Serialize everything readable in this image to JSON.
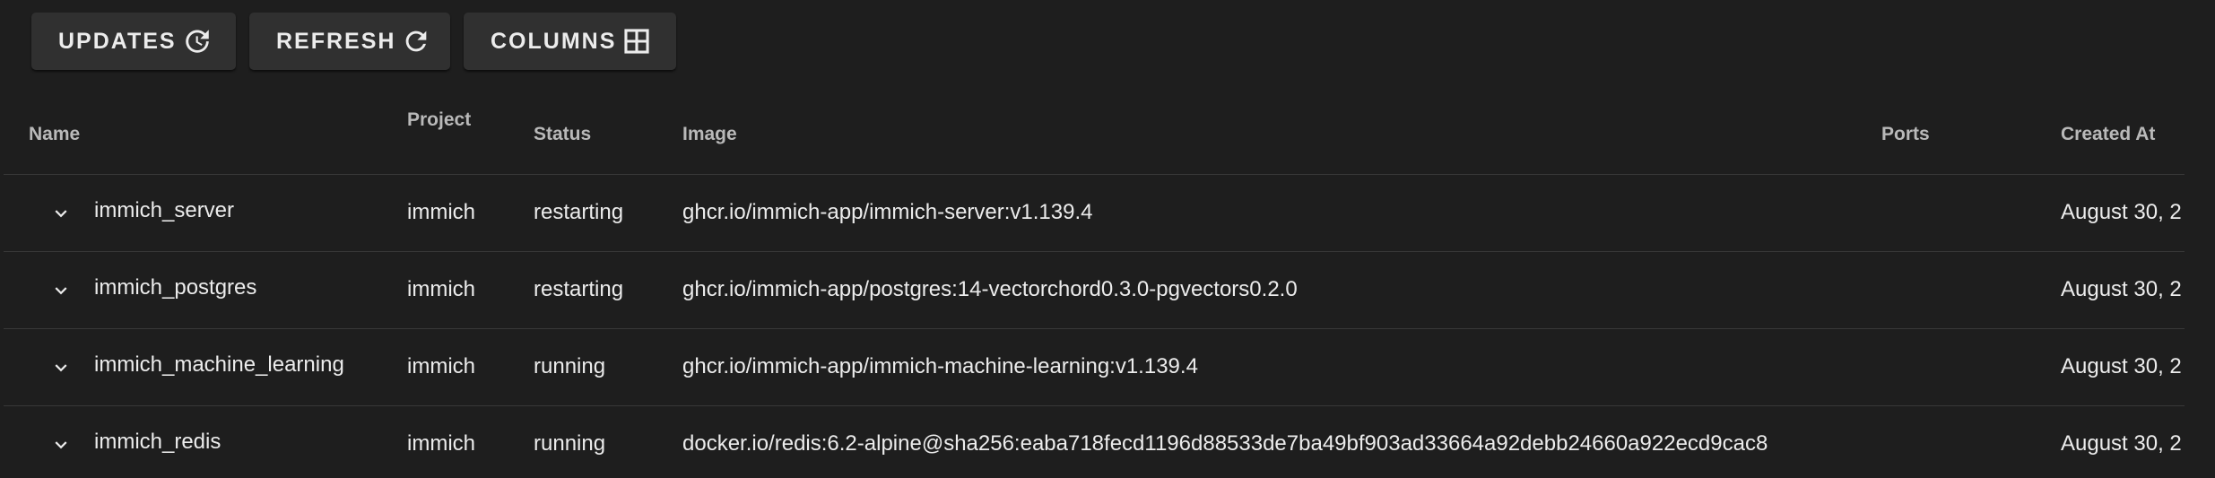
{
  "toolbar": {
    "updates_label": "UPDATES",
    "updates_icon": "update-history-icon",
    "refresh_label": "REFRESH",
    "refresh_icon": "refresh-icon",
    "columns_label": "COLUMNS",
    "columns_icon": "columns-grid-icon"
  },
  "table": {
    "headers": {
      "name": "Name",
      "project": "Project",
      "status": "Status",
      "image": "Image",
      "ports": "Ports",
      "created": "Created At"
    },
    "rows": [
      {
        "name": "immich_server",
        "project": "immich",
        "status": "restarting",
        "image": "ghcr.io/immich-app/immich-server:v1.139.4",
        "ports": "",
        "created": "August 30, 2"
      },
      {
        "name": "immich_postgres",
        "project": "immich",
        "status": "restarting",
        "image": "ghcr.io/immich-app/postgres:14-vectorchord0.3.0-pgvectors0.2.0",
        "ports": "",
        "created": "August 30, 2"
      },
      {
        "name": "immich_machine_learning",
        "project": "immich",
        "status": "running",
        "image": "ghcr.io/immich-app/immich-machine-learning:v1.139.4",
        "ports": "",
        "created": "August 30, 2"
      },
      {
        "name": "immich_redis",
        "project": "immich",
        "status": "running",
        "image": "docker.io/redis:6.2-alpine@sha256:eaba718fecd1196d88533de7ba49bf903ad33664a92debb24660a922ecd9cac8",
        "ports": "",
        "created": "August 30, 2"
      }
    ]
  },
  "colors": {
    "background": "#1e1e1e",
    "button": "#303030",
    "text": "#ececec",
    "header_text": "#b9b9b9",
    "divider": "#383838"
  }
}
